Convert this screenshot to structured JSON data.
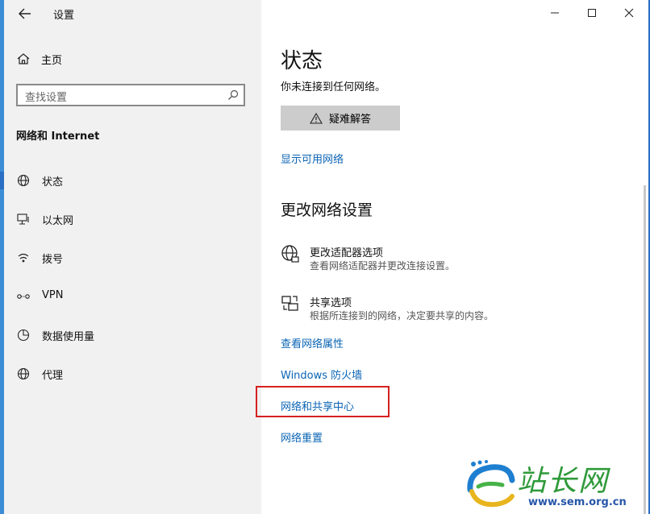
{
  "window": {
    "title": "设置",
    "back_icon": "arrow-left-icon",
    "controls": [
      "minimize",
      "maximize",
      "close"
    ]
  },
  "sidebar": {
    "home_label": "主页",
    "search_placeholder": "查找设置",
    "section_title": "网络和 Internet",
    "items": [
      {
        "label": "状态",
        "icon": "globe-icon",
        "selected": true
      },
      {
        "label": "以太网",
        "icon": "ethernet-icon",
        "selected": false
      },
      {
        "label": "拨号",
        "icon": "dialup-icon",
        "selected": false
      },
      {
        "label": "VPN",
        "icon": "vpn-icon",
        "selected": false
      },
      {
        "label": "数据使用量",
        "icon": "data-usage-icon",
        "selected": false
      },
      {
        "label": "代理",
        "icon": "globe-icon",
        "selected": false
      }
    ]
  },
  "main": {
    "title": "状态",
    "status_text": "你未连接到任何网络。",
    "troubleshoot_label": "疑难解答",
    "show_networks_link": "显示可用网络",
    "change_heading": "更改网络设置",
    "options": [
      {
        "title": "更改适配器选项",
        "desc": "查看网络适配器并更改连接设置。",
        "icon": "adapter-globe-icon"
      },
      {
        "title": "共享选项",
        "desc": "根据所连接到的网络，决定要共享的内容。",
        "icon": "sharing-icon"
      }
    ],
    "links": {
      "properties": "查看网络属性",
      "firewall": "Windows 防火墙",
      "sharing_center": "网络和共享中心",
      "reset": "网络重置"
    }
  },
  "watermark": {
    "name": "站长网",
    "url": "www.sem.org.cn"
  },
  "colors": {
    "accent": "#2a6fc4",
    "link": "#0a64b4",
    "highlight": "#d62020",
    "sidebar_bg": "#f1f1f1"
  }
}
